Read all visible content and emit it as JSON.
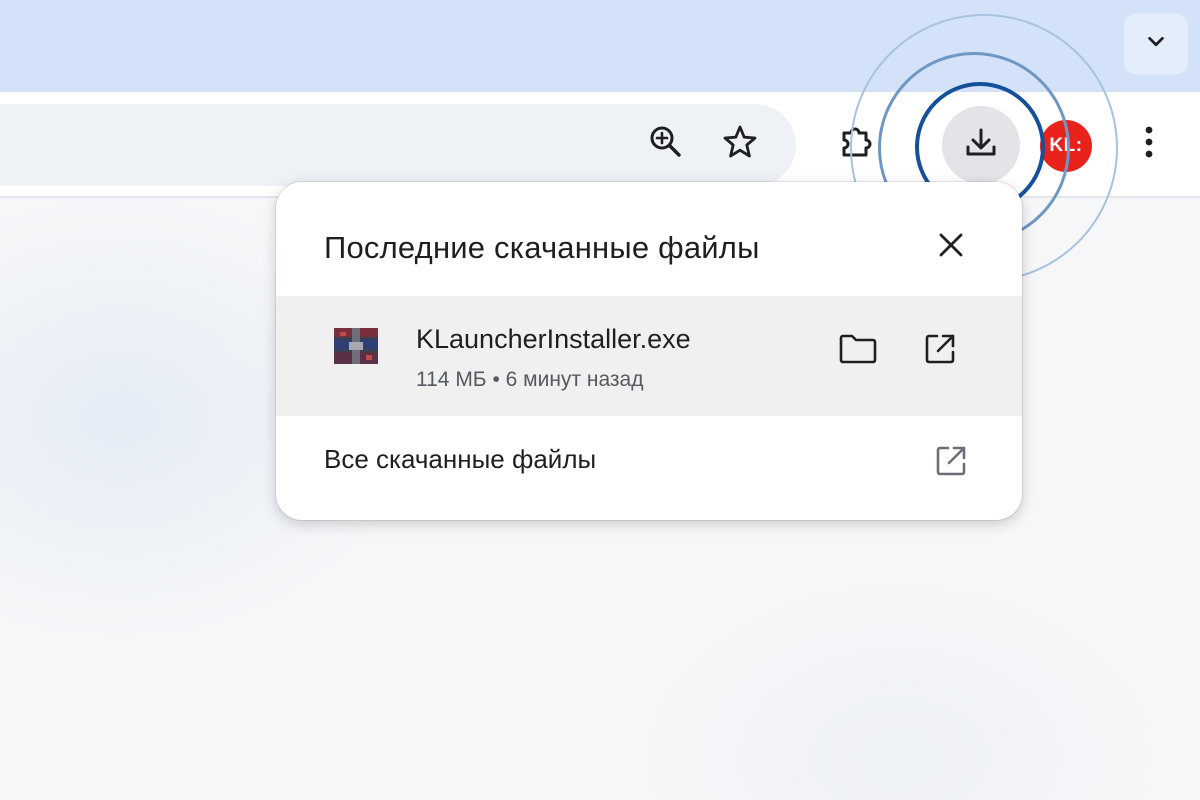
{
  "browser": {
    "avatar_text": "KL:",
    "avatar_color": "#e8231c",
    "icons": {
      "tab_search": "chevron-down-icon",
      "zoom": "zoom-in-icon",
      "bookmark": "star-icon",
      "extensions": "puzzle-piece-icon",
      "downloads": "download-icon",
      "menu": "more-vert-icon"
    }
  },
  "downloads_popup": {
    "title": "Последние скачанные файлы",
    "items": [
      {
        "file_name": "KLauncherInstaller.exe",
        "size": "114 МБ",
        "separator": "•",
        "time": "6 минут назад",
        "icon": "winrar-archive-icon"
      }
    ],
    "all_downloads_label": "Все скачанные файлы"
  },
  "colors": {
    "tab_strip": "#d3e2f9",
    "highlight_ring": "#15519a",
    "row_highlight": "#f0f0f0"
  }
}
